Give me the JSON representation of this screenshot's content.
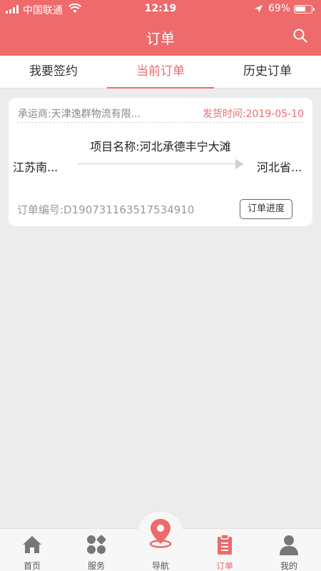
{
  "status_bar": {
    "carrier": "中国联通",
    "time": "12:19",
    "battery": "69%",
    "battery_level": 0.69
  },
  "nav": {
    "title": "订单",
    "search_icon": "search-icon"
  },
  "tabs": [
    {
      "label": "我要签约",
      "active": false
    },
    {
      "label": "当前订单",
      "active": true
    },
    {
      "label": "历史订单",
      "active": false
    }
  ],
  "order": {
    "carrier": "承运商:天津逸群物流有限...",
    "ship_time": "发货时间:2019-05-10",
    "project": "项目名称:河北承德丰宁大滩",
    "origin": "江苏南...",
    "destination": "河北省...",
    "order_no": "订单编号:D190731163517534910",
    "progress_button": "订单进度"
  },
  "tabbar": [
    {
      "label": "首页",
      "icon": "home-icon"
    },
    {
      "label": "服务",
      "icon": "services-icon"
    },
    {
      "label": "导航",
      "icon": "location-pin-icon"
    },
    {
      "label": "订单",
      "icon": "clipboard-icon",
      "active": true
    },
    {
      "label": "我的",
      "icon": "user-icon"
    }
  ],
  "colors": {
    "accent": "#ee6a6b",
    "background": "#ececec"
  }
}
